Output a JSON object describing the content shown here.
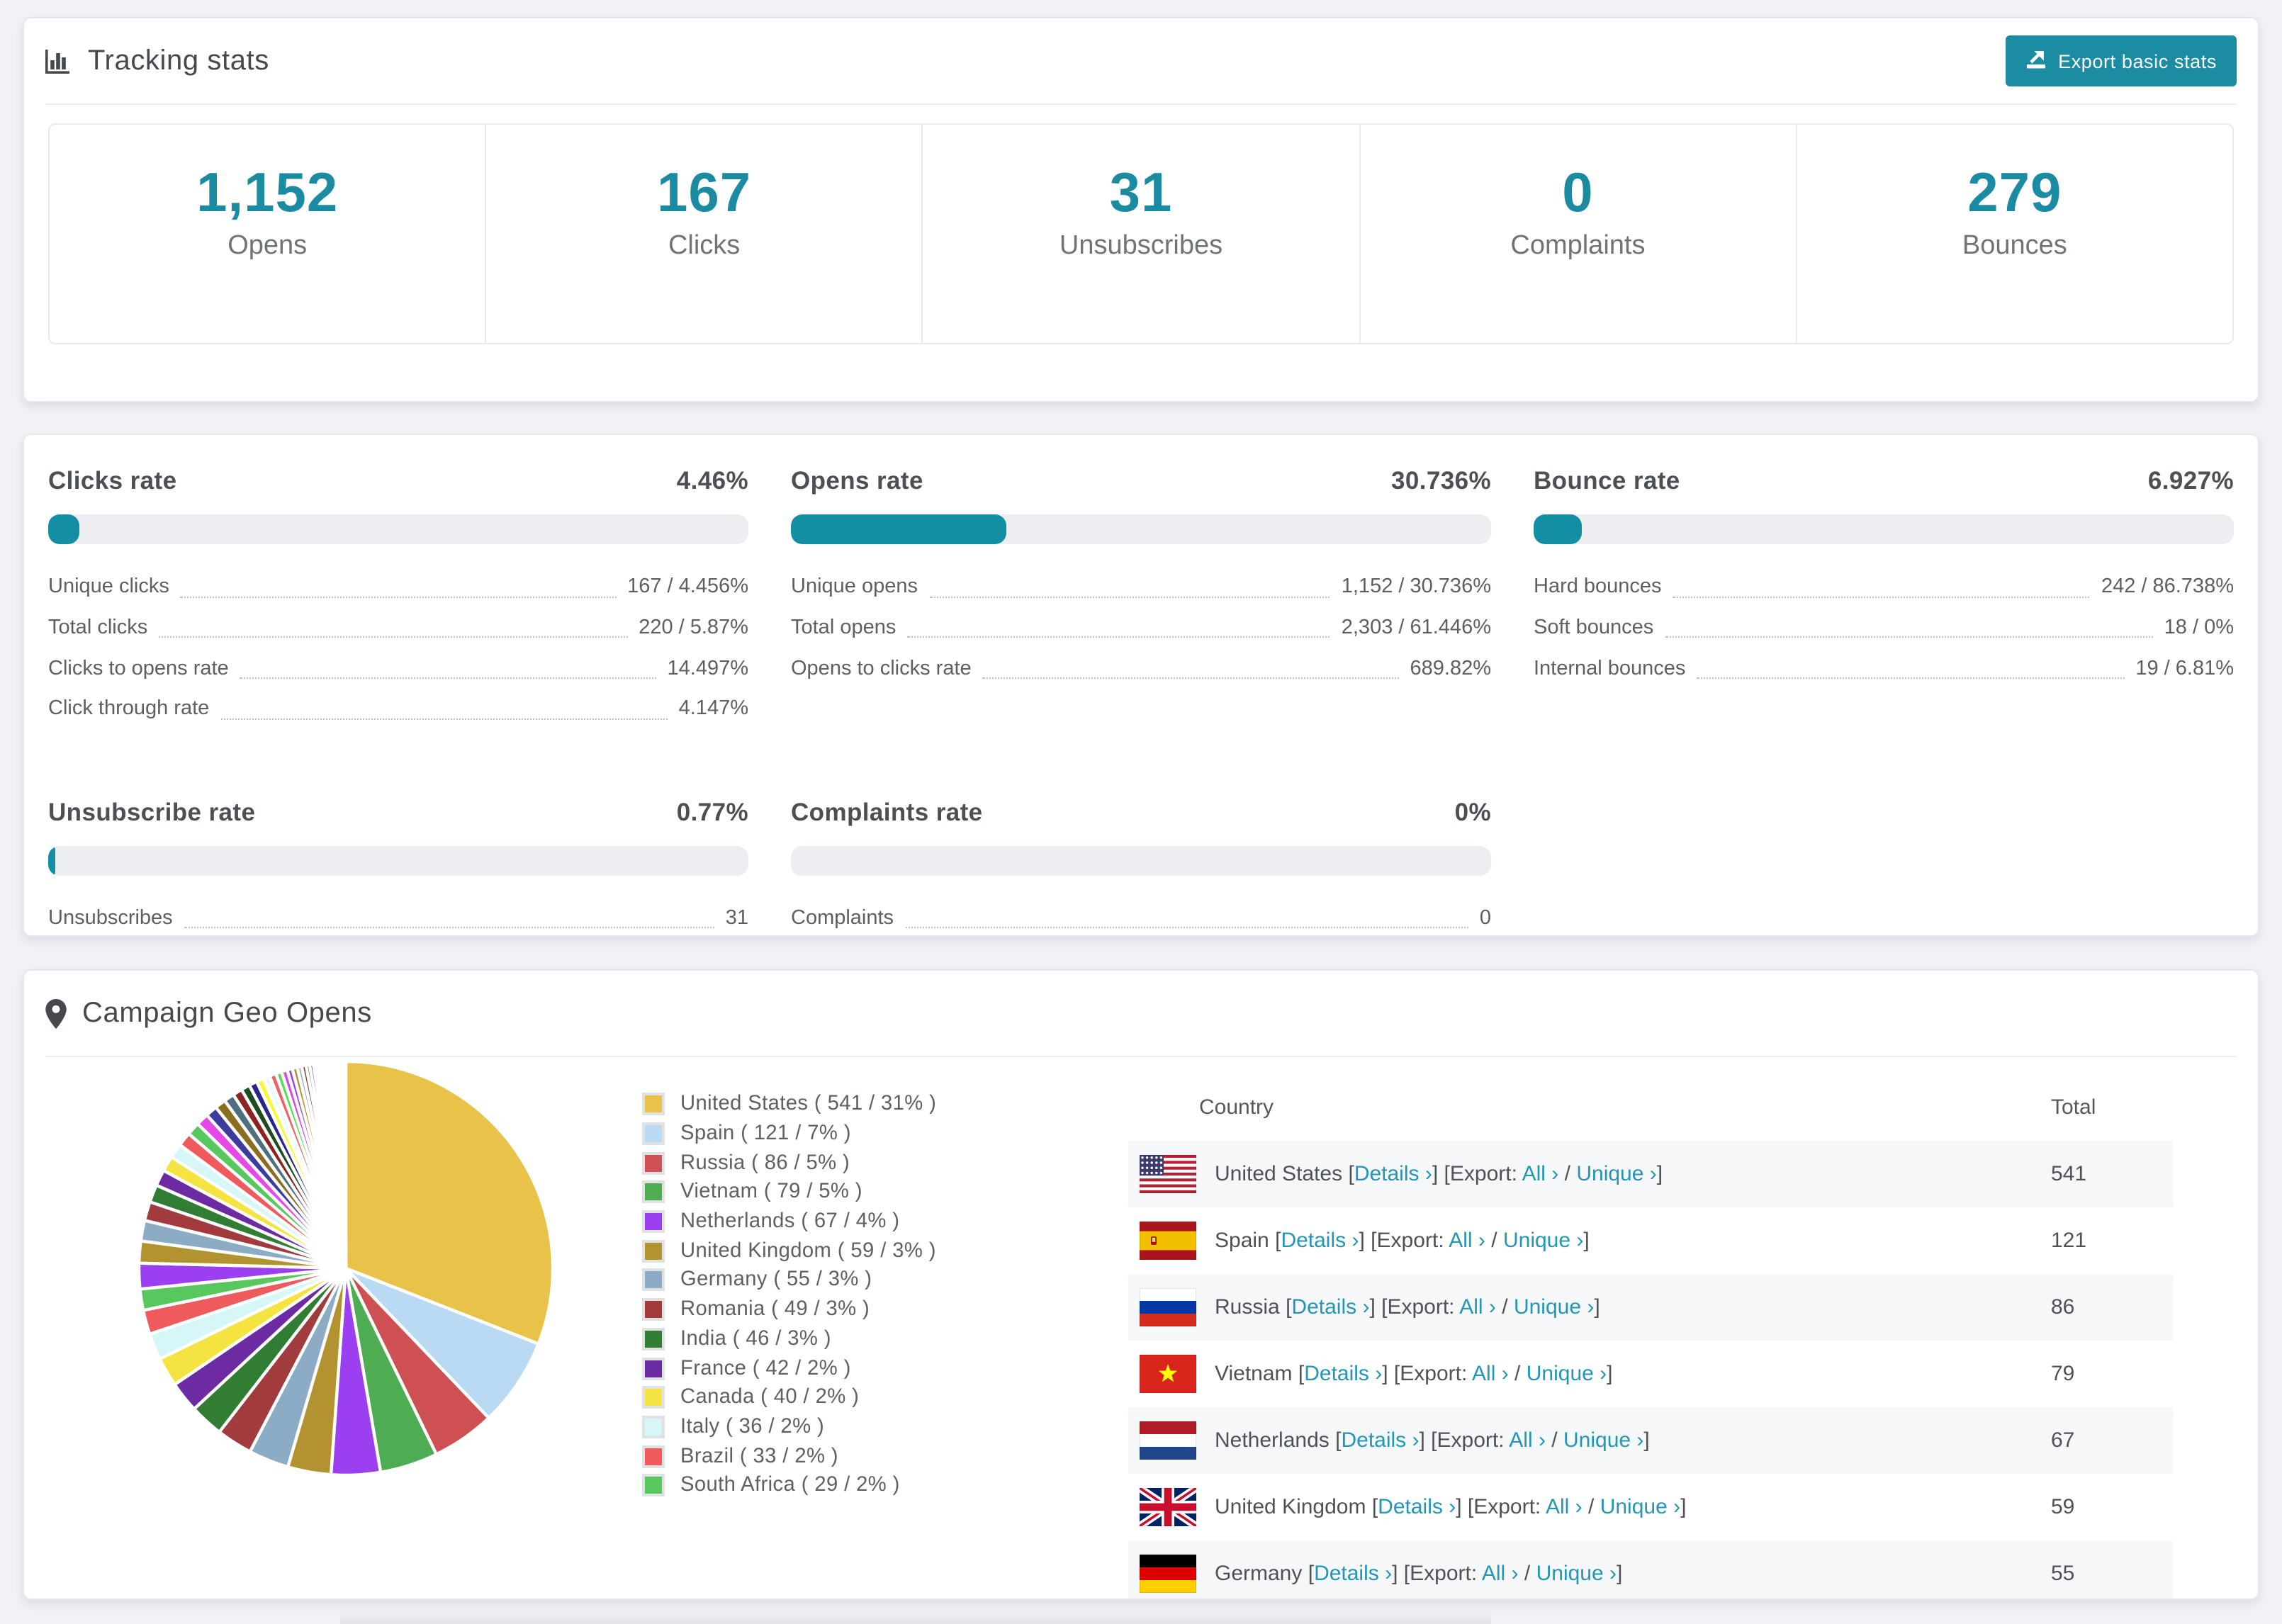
{
  "accent": "#1b8ca2",
  "link_color": "#2296b4",
  "header": {
    "title": "Tracking stats",
    "export_label": "Export basic stats"
  },
  "summary": [
    {
      "value": "1,152",
      "label": "Opens"
    },
    {
      "value": "167",
      "label": "Clicks"
    },
    {
      "value": "31",
      "label": "Unsubscribes"
    },
    {
      "value": "0",
      "label": "Complaints"
    },
    {
      "value": "279",
      "label": "Bounces"
    }
  ],
  "rates": [
    {
      "title": "Clicks rate",
      "value": "4.46%",
      "percent": 4.46,
      "rows": [
        [
          "Unique clicks",
          "167 / 4.456%"
        ],
        [
          "Total clicks",
          "220 / 5.87%"
        ],
        [
          "Clicks to opens rate",
          "14.497%"
        ],
        [
          "Click through rate",
          "4.147%"
        ]
      ]
    },
    {
      "title": "Opens rate",
      "value": "30.736%",
      "percent": 30.736,
      "rows": [
        [
          "Unique opens",
          "1,152 / 30.736%"
        ],
        [
          "Total opens",
          "2,303 / 61.446%"
        ],
        [
          "Opens to clicks rate",
          "689.82%"
        ]
      ]
    },
    {
      "title": "Bounce rate",
      "value": "6.927%",
      "percent": 6.927,
      "rows": [
        [
          "Hard bounces",
          "242 / 86.738%"
        ],
        [
          "Soft bounces",
          "18 / 0%"
        ],
        [
          "Internal bounces",
          "19 / 6.81%"
        ]
      ]
    },
    {
      "title": "Unsubscribe rate",
      "value": "0.77%",
      "percent": 0.77,
      "rows": [
        [
          "Unsubscribes",
          "31"
        ]
      ]
    },
    {
      "title": "Complaints rate",
      "value": "0%",
      "percent": 0,
      "rows": [
        [
          "Complaints",
          "0"
        ]
      ]
    }
  ],
  "geo": {
    "title": "Campaign Geo Opens",
    "table": {
      "columns": [
        "Country",
        "Total"
      ],
      "links": {
        "details": "Details ›",
        "export_prefix": "Export:",
        "all": "All ›",
        "unique": "Unique ›"
      },
      "rows": [
        {
          "flag": "us",
          "country": "United States",
          "total": "541"
        },
        {
          "flag": "es",
          "country": "Spain",
          "total": "121"
        },
        {
          "flag": "ru",
          "country": "Russia",
          "total": "86"
        },
        {
          "flag": "vn",
          "country": "Vietnam",
          "total": "79"
        },
        {
          "flag": "nl",
          "country": "Netherlands",
          "total": "67"
        },
        {
          "flag": "gb",
          "country": "United Kingdom",
          "total": "59"
        },
        {
          "flag": "de",
          "country": "Germany",
          "total": "55"
        }
      ]
    }
  },
  "chart_data": {
    "type": "pie",
    "title": "Campaign Geo Opens",
    "legend_position": "right",
    "labels": [
      "United States",
      "Spain",
      "Russia",
      "Vietnam",
      "Netherlands",
      "United Kingdom",
      "Germany",
      "Romania",
      "India",
      "France",
      "Canada",
      "Italy",
      "Brazil",
      "South Africa"
    ],
    "values": [
      541,
      121,
      86,
      79,
      67,
      59,
      55,
      49,
      46,
      42,
      40,
      36,
      33,
      29
    ],
    "percents": [
      31,
      7,
      5,
      5,
      4,
      3,
      3,
      3,
      3,
      2,
      2,
      2,
      2,
      2
    ],
    "colors": [
      "#e9c349",
      "#b9daf2",
      "#cf5052",
      "#4ead53",
      "#9c3ff0",
      "#b3932f",
      "#8cacc6",
      "#a23b3d",
      "#307d33",
      "#6d2ba3",
      "#f5e342",
      "#d6f6f7",
      "#ef5b5c",
      "#58c75d"
    ],
    "other_slices": {
      "values": [
        35,
        30,
        28,
        26,
        24,
        22,
        21,
        20,
        19,
        18,
        17,
        16,
        15,
        14,
        13,
        12,
        11,
        10,
        9,
        9,
        8,
        8,
        7,
        7,
        6,
        6,
        5,
        5,
        4,
        4,
        3,
        3,
        3,
        3,
        2,
        2,
        2,
        2,
        2,
        2,
        1,
        1,
        1,
        1,
        1,
        1,
        1,
        1,
        1,
        1,
        1,
        1
      ],
      "colors_cycle": [
        "#9c3ff0",
        "#b3932f",
        "#8cacc6",
        "#a23b3d",
        "#307d33",
        "#6d2ba3",
        "#f5e342",
        "#d6f6f7",
        "#ef5b5c",
        "#58c75d",
        "#e649e6",
        "#3c3c9e",
        "#8a6d1f",
        "#4f6f7e",
        "#8c2222",
        "#1d4c1f",
        "#27278e",
        "#f7f73b",
        "#eefafa",
        "#f06060",
        "#52e052",
        "#d44fd9"
      ]
    }
  }
}
